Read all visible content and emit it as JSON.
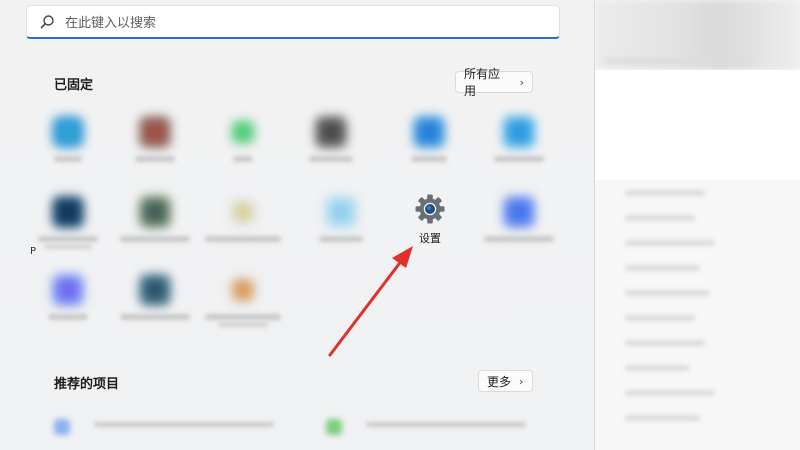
{
  "search": {
    "placeholder": "在此键入以搜索"
  },
  "pinned": {
    "title": "已固定",
    "all_apps_label": "所有应用",
    "settings_label": "设置",
    "partial_edge_label": "P"
  },
  "recommended": {
    "title": "推荐的项目",
    "more_label": "更多"
  },
  "colors": {
    "accent": "#2a6fc9",
    "arrow": "#e0302a"
  }
}
